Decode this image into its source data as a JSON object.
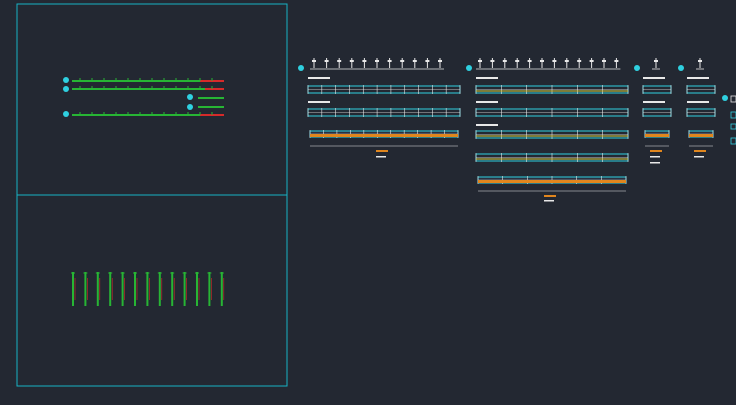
{
  "canvas": {
    "background": "#232832"
  },
  "colors": {
    "frame": "#17b2c4",
    "beam_green": "#27b534",
    "beam_red": "#d62a2a",
    "cyan": "#2fd0e0",
    "white": "#e8e8e8",
    "orange": "#e0861e",
    "yellow": "#d8d040"
  },
  "viewports": [
    {
      "name": "top-left-viewport",
      "content": "beam-plan-elevations"
    },
    {
      "name": "bottom-left-viewport",
      "content": "column-elevations"
    }
  ],
  "drawing_groups": [
    {
      "name": "detail-group-1",
      "bays": 11
    },
    {
      "name": "detail-group-2",
      "bays": 6
    },
    {
      "name": "detail-group-3",
      "bays": 1
    },
    {
      "name": "detail-group-4",
      "bays": 1
    }
  ],
  "column_count": 13,
  "title_marker_count": 5
}
